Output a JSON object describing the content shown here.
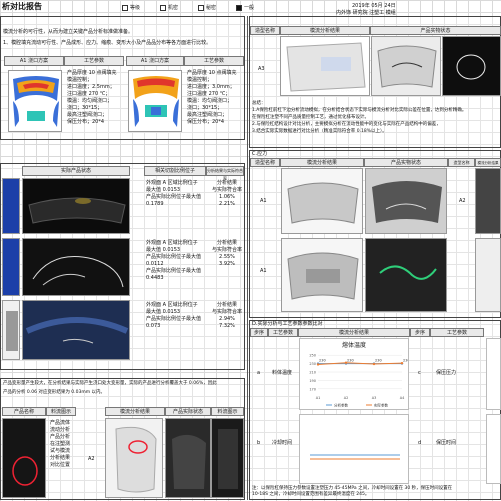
{
  "header": {
    "title": "析对比报告",
    "checks": [
      {
        "label": "等级",
        "checked": false
      },
      {
        "label": "机密",
        "checked": false
      },
      {
        "label": "秘密",
        "checked": false
      },
      {
        "label": "一般",
        "checked": true
      }
    ],
    "date": "2019年 05月 24日",
    "dept": "内外饰 研究院 注塑工 模组"
  },
  "left": {
    "section_a": {
      "lines": [
        "模流分析的可行性，从而为建立关键产品分析标准做准备。",
        "1、模腔填充流动可行性、产品成形、应力、缩痕、变形大小及产品品分布等各方面进行比较。"
      ],
      "col_headers": [
        "A1 浇口方案",
        "工艺参数",
        "A1 浇口方案",
        "工艺参数"
      ],
      "params_a": [
        "产品厚度 10 点阀填充",
        "模温控制；",
        "进口温度；2.5mm；",
        "注口温度 270 ℃；",
        "模温：均匀阀浇口；",
        "浇口；30*15；",
        "最高注塑阀浇口；",
        "保压分布；20*4"
      ],
      "params_b": [
        "产品厚度 10 点阀填充",
        "模温控制；",
        "进口温度；3.0mm；",
        "注口温度 270 ℃；",
        "模温：均匀阀浇口；",
        "浇口；30*15；",
        "最高注塑阀浇口；",
        "保压分布；20*4"
      ]
    },
    "section_b": {
      "col_headers": [
        "实际产品状态",
        "相关切割比例位子",
        "分析结果与实际符合率"
      ],
      "rows": [
        {
          "text": [
            "外观面 A 区域比例位子",
            "最大值 0.0153",
            "",
            "产品实际比例位子最大值",
            "0.1789"
          ],
          "rate": [
            "分析结果",
            "与实际符合率",
            "1.06%",
            "2.21%"
          ]
        },
        {
          "text": [
            "外观面 A 区域比例位子",
            "最大值 0.0153",
            "",
            "产品实际比例位子最大值",
            "0.0112",
            "产品实际比例位子最大值",
            "0.4483"
          ],
          "rate": [
            "分析结果",
            "与实际符合率",
            "2.55%",
            "3.92%"
          ]
        },
        {
          "text": [
            "外观面 A 区域比例位子",
            "最大值 0.0153",
            "",
            "产品实际比例位子最大值",
            "0.073"
          ],
          "rate": [
            "分析结果",
            "与实际符合率",
            "2.94%",
            "7.32%"
          ]
        }
      ]
    },
    "section_c": {
      "lines": [
        "产品变形量产生较大，在分析结果与实际产生浇口处大变形量，实际的产品进行分析覆盖大于 0.06%，因此",
        "产品的分析 0.06 对应变形结果为 0.03mm 以内。"
      ],
      "col_headers": [
        "产品名称",
        "料流图示",
        "模流分析结果",
        "产品实际状态",
        "料流图示"
      ],
      "row_text": [
        "产品流体",
        "流动分析",
        "产品分析",
        "在注塑测",
        "试与模流",
        "分析结果",
        "对比位置"
      ],
      "row_id": "A2"
    }
  },
  "right": {
    "top": {
      "col_headers": [
        "造型名称",
        "模流分析结果",
        "产品实物状态"
      ],
      "row_id": "A3",
      "notes": [
        "总结：",
        "1.A保险杠前杠下边分析流动模拟，在分析结合状态下实际与模流分析对比实际公差在位置，达到分析精确。",
        "在保险杠注塑不同产品质量控制工艺，通过优化排布设计。",
        "2.与保险杠结构设计对比分析，主要模拟分析在流动性能中的变化与实际在产品结构中的偏差，",
        "3.结合实际实际数据进行对比分析（精准实际符合率 0.18%以上）。"
      ]
    },
    "mid": {
      "title": "C.应力",
      "col_headers": [
        "造型名称",
        "模流分析结果",
        "产品实物状态",
        "造型名称",
        "模流分析结果"
      ],
      "row_ids": [
        "A1",
        "A2"
      ]
    },
    "bottom": {
      "title": "D.实际分析与工艺参数参数比对",
      "col_headers": [
        "步序",
        "工艺参数",
        "模流分析结果",
        "步序",
        "工艺参数"
      ],
      "rows": [
        {
          "id": "a",
          "label": "料体温度",
          "id2": "c",
          "label2": "保压压力"
        },
        {
          "id": "b",
          "label": "冷却时间",
          "id2": "d",
          "label2": "保压时间"
        }
      ],
      "notes": [
        "注：以保险杠保持压力参数设置注塑压力 45-45MPa 之间，冷却时间设置在 30 秒，保压时间设置在",
        "10-18S 之间，冷却时间设置范围有差异最终温度在 245。"
      ]
    }
  },
  "chart_data": {
    "type": "line",
    "title": "熔体温度",
    "categories": [
      "A1",
      "A2",
      "A3",
      "A4"
    ],
    "ylim": [
      160,
      260
    ],
    "yticks": [
      "250",
      "230",
      "210",
      "190",
      "170"
    ],
    "series": [
      {
        "name": "分析参数",
        "values": [
          230,
          230,
          230,
          230
        ]
      },
      {
        "name": "实际参数",
        "values": [
          228,
          232,
          229,
          231
        ]
      }
    ],
    "data_labels": [
      "230",
      "230",
      "230",
      "230"
    ],
    "colors": [
      "#5b9bd5",
      "#ed7d31"
    ]
  },
  "colors": {
    "grid": "#c9c9c9",
    "header": "#e9e9e9"
  }
}
